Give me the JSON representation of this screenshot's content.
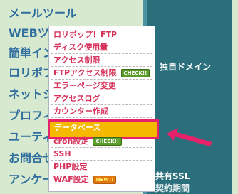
{
  "sidebar": {
    "items": [
      {
        "label": "メールツール"
      },
      {
        "label": "WEBツー"
      },
      {
        "label": "簡単イン"
      },
      {
        "label": "ロリポブ"
      },
      {
        "label": "ネットショ"
      },
      {
        "label": "プロフィ"
      },
      {
        "label": "ユーティ"
      },
      {
        "label": "お問合せ"
      },
      {
        "label": "アンケー"
      }
    ]
  },
  "right": {
    "domain_label": "独自ドメイン",
    "shared_ssl": "共有SSL",
    "bottom_cut": "契約期間"
  },
  "menu": {
    "items": [
      {
        "label": "ロリポップ！FTP"
      },
      {
        "label": "ディスク使用量"
      },
      {
        "label": "アクセス制限"
      },
      {
        "label": "FTPアクセス制限",
        "badge": "CHECK!!"
      },
      {
        "label": "エラーページ変更"
      },
      {
        "label": "アクセスログ"
      },
      {
        "label": "カウンター作成"
      },
      {
        "label": "データベース"
      },
      {
        "label": "cron設定",
        "badge": "CHECK!!"
      },
      {
        "label": "SSH"
      },
      {
        "label": "PHP設定"
      },
      {
        "label": "WAF設定",
        "badge": "NEW!!"
      }
    ]
  },
  "colors": {
    "menu_text": "#d6325a",
    "highlight_bg": "#f5b900",
    "highlight_border": "#e6236a",
    "sidebar_text": "#2f6e9e",
    "panel_teal": "#2b6f7c"
  }
}
